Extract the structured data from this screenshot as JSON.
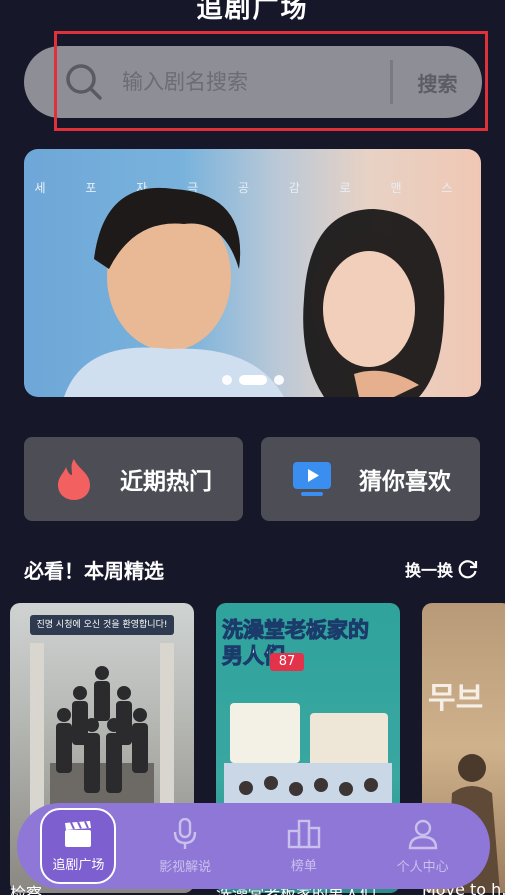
{
  "header": {
    "title": "追剧广场"
  },
  "search": {
    "placeholder": "输入剧名搜索",
    "button_label": "搜索"
  },
  "banner": {
    "overlay_text": "세 포 자 극 공 감 로 맨 스",
    "slide_count": 3,
    "active_slide": 1
  },
  "categories": [
    {
      "label": "近期热门",
      "icon": "flame-icon",
      "icon_color": "#f26060"
    },
    {
      "label": "猜你喜欢",
      "icon": "play-screen-icon",
      "icon_color": "#3a8ef0"
    }
  ],
  "weekly": {
    "title": "必看！本周精选",
    "refresh_label": "换一换",
    "posters": [
      {
        "banner_text": "진명 시청에 오신 것을 환영합니다!",
        "caption": "检察…"
      },
      {
        "title_text": "洗澡堂老板家的男人们",
        "badge": "87",
        "caption": "洗澡堂老板家的男人们"
      },
      {
        "title_text": "무브",
        "caption": "Move to h…"
      }
    ]
  },
  "tabbar": {
    "items": [
      {
        "label": "追剧广场",
        "icon": "clapperboard-icon",
        "active": true
      },
      {
        "label": "影视解说",
        "icon": "microphone-icon",
        "active": false
      },
      {
        "label": "榜单",
        "icon": "ranking-chart-icon",
        "active": false
      },
      {
        "label": "个人中心",
        "icon": "person-icon",
        "active": false
      }
    ]
  },
  "colors": {
    "background": "#17172a",
    "accent": "#8f77d8",
    "search_highlight": "#e0303a",
    "card": "#4d4d55"
  }
}
